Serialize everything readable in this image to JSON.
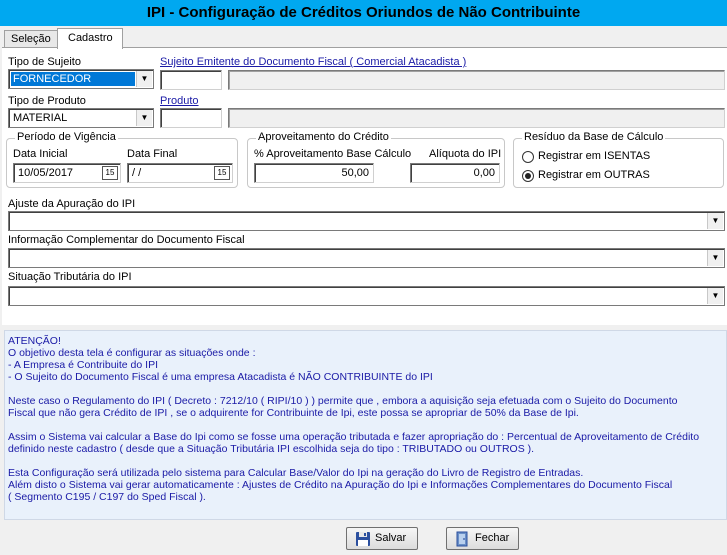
{
  "window": {
    "title": "IPI - Configuração de Créditos Oriundos de Não Contribuinte"
  },
  "tabs": [
    {
      "label": "Seleção"
    },
    {
      "label": "Cadastro"
    }
  ],
  "form": {
    "tipo_sujeito_label": "Tipo de Sujeito",
    "tipo_sujeito_value": "FORNECEDOR",
    "sujeito_link": "Sujeito Emitente do Documento Fiscal ( Comercial Atacadista )",
    "sujeito_code": "",
    "sujeito_name": "",
    "tipo_produto_label": "Tipo de Produto",
    "tipo_produto_value": "MATERIAL",
    "produto_link": "Produto",
    "produto_code": "",
    "produto_name": ""
  },
  "vigencia": {
    "title": "Período de Vigência",
    "data_inicial_label": "Data Inicial",
    "data_inicial_value": "10/05/2017",
    "data_final_label": "Data Final",
    "data_final_value": "/ /",
    "calendar_glyph": "15"
  },
  "aproveitamento": {
    "title": "Aproveitamento do Crédito",
    "base_label": "% Aproveitamento Base Cálculo",
    "base_value": "50,00",
    "aliquota_label": "Alíquota do IPI",
    "aliquota_value": "0,00"
  },
  "residuo": {
    "title": "Resíduo da Base de Cálculo",
    "option_isentas": "Registrar em ISENTAS",
    "option_outras": "Registrar em OUTRAS",
    "selected": "Registrar em OUTRAS"
  },
  "ajuste": {
    "label": "Ajuste da Apuração do IPI",
    "value": ""
  },
  "info_complementar": {
    "label": "Informação Complementar do Documento Fiscal",
    "value": ""
  },
  "situacao": {
    "label": "Situação Tributária do IPI",
    "value": ""
  },
  "notice": {
    "lines": [
      "ATENÇÃO!",
      "O objetivo desta tela é configurar as situações onde :",
      "- A Empresa é Contribuite do IPI",
      "- O Sujeito do Documento Fiscal é uma empresa Atacadista é NÃO CONTRIBUINTE do IPI",
      "",
      "Neste caso o Regulamento do IPI ( Decreto : 7212/10 ( RIPI/10 ) ) permite que , embora a aquisição seja efetuada com o Sujeito do Documento",
      "Fiscal que não gera Crédito de IPI , se o adquirente for Contribuinte de Ipi, este possa se apropriar de 50% da Base de Ipi.",
      "",
      "Assim o Sistema vai calcular a Base do Ipi como se fosse uma operação tributada e fazer apropriação do : Percentual de Aproveitamento de Crédito",
      "definido neste cadastro ( desde que a Situação Tributária IPI escolhida seja do tipo : TRIBUTADO ou OUTROS ).",
      "",
      "Esta Configuração será utilizada pelo sistema para Calcular Base/Valor do Ipi na geração do Livro de Registro de Entradas.",
      "Além disto o Sistema vai gerar automaticamente : Ajustes de Crédito na Apuração do Ipi e Informações Complementares do Documento Fiscal",
      "( Segmento C195 / C197 do Sped Fiscal )."
    ]
  },
  "buttons": {
    "salvar": "Salvar",
    "fechar": "Fechar"
  },
  "icons": {
    "dropdown": "chevron-down-icon",
    "save": "floppy-disk-icon",
    "close": "exit-door-icon",
    "calendar": "calendar-icon"
  },
  "colors": {
    "titlebar": "#00a8f0",
    "link": "#1a1aa6",
    "selection": "#0078d7",
    "notice_bg": "#e9f1fb"
  }
}
